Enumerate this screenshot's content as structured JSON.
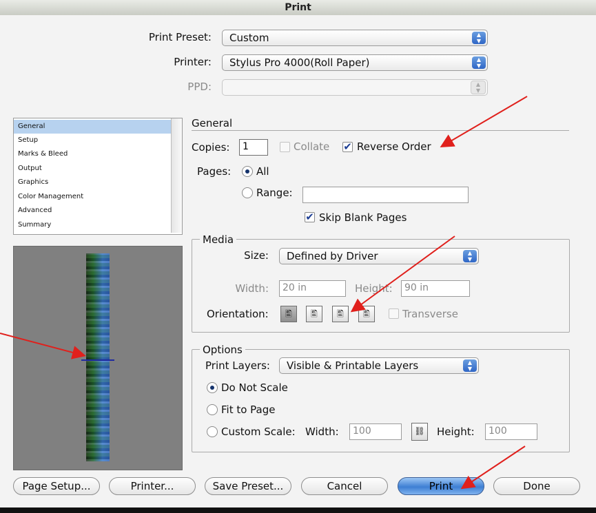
{
  "window": {
    "title": "Print"
  },
  "top": {
    "print_preset_label": "Print Preset:",
    "print_preset_value": "Custom",
    "printer_label": "Printer:",
    "printer_value": "Stylus Pro 4000(Roll Paper)",
    "ppd_label": "PPD:",
    "ppd_value": ""
  },
  "sidebar": {
    "items": [
      {
        "label": "General"
      },
      {
        "label": "Setup"
      },
      {
        "label": "Marks & Bleed"
      },
      {
        "label": "Output"
      },
      {
        "label": "Graphics"
      },
      {
        "label": "Color Management"
      },
      {
        "label": "Advanced"
      },
      {
        "label": "Summary"
      }
    ],
    "selected": "General"
  },
  "general": {
    "title": "General",
    "copies_label": "Copies:",
    "copies_value": "1",
    "collate_label": "Collate",
    "collate_checked": false,
    "reverse_order_label": "Reverse Order",
    "reverse_order_checked": true,
    "pages_label": "Pages:",
    "all_label": "All",
    "range_label": "Range:",
    "range_value": "",
    "skip_blank_label": "Skip Blank Pages",
    "skip_blank_checked": true
  },
  "media": {
    "title": "Media",
    "size_label": "Size:",
    "size_value": "Defined by Driver",
    "width_label": "Width:",
    "width_value": "20 in",
    "height_label": "Height:",
    "height_value": "90 in",
    "orientation_label": "Orientation:",
    "transverse_label": "Transverse"
  },
  "options": {
    "title": "Options",
    "print_layers_label": "Print Layers:",
    "print_layers_value": "Visible & Printable Layers",
    "do_not_scale_label": "Do Not Scale",
    "fit_to_page_label": "Fit to Page",
    "custom_scale_label": "Custom Scale:",
    "width_label": "Width:",
    "width_value": "100",
    "height_label": "Height:",
    "height_value": "100"
  },
  "buttons": {
    "page_setup": "Page Setup...",
    "printer": "Printer...",
    "save_preset": "Save Preset...",
    "cancel": "Cancel",
    "print": "Print",
    "done": "Done"
  },
  "colors": {
    "annotation_arrow": "#e0201c",
    "default_button": "#3e7fd3",
    "selection": "#b7d2ef"
  }
}
